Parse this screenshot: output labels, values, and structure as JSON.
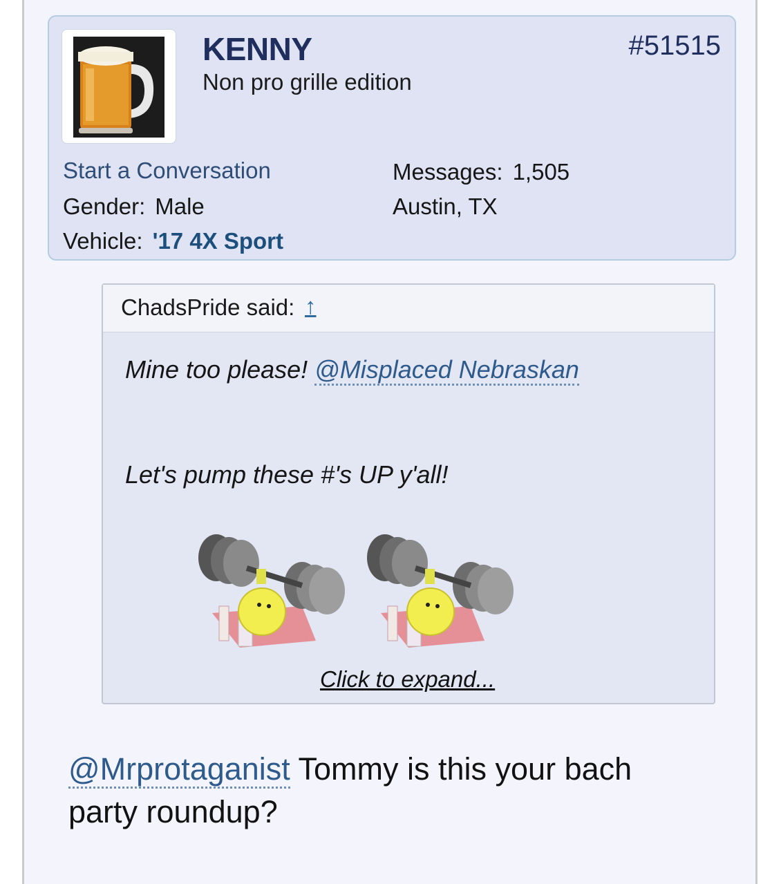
{
  "user": {
    "name": "KENNY",
    "title": "Non pro grille edition",
    "post_number": "#51515",
    "start_conversation": "Start a Conversation",
    "gender_label": "Gender:",
    "gender_value": "Male",
    "vehicle_label": "Vehicle:",
    "vehicle_value": "'17 4X Sport",
    "messages_label": "Messages:",
    "messages_value": "1,505",
    "location": "Austin, TX",
    "avatar": "beer-mug-avatar"
  },
  "quote": {
    "author": "ChadsPride said:",
    "jump_arrow": "↑",
    "line1_text": "Mine too please! ",
    "line1_mention": "@Misplaced Nebraskan",
    "line2_text": "Let's pump these #'s UP y'all!",
    "smilies": [
      "weightlifting-smiley",
      "weightlifting-smiley"
    ],
    "expand_label": "Click to expand..."
  },
  "reply": {
    "mention": "@Mrprotaganist",
    "text": " Tommy is this your bach party roundup?"
  },
  "colors": {
    "card_bg": "#dfe3f3",
    "card_border": "#b3cce2",
    "username": "#1f2e5c",
    "link": "#2e5a8c",
    "quote_bg": "#e3e6f3"
  }
}
